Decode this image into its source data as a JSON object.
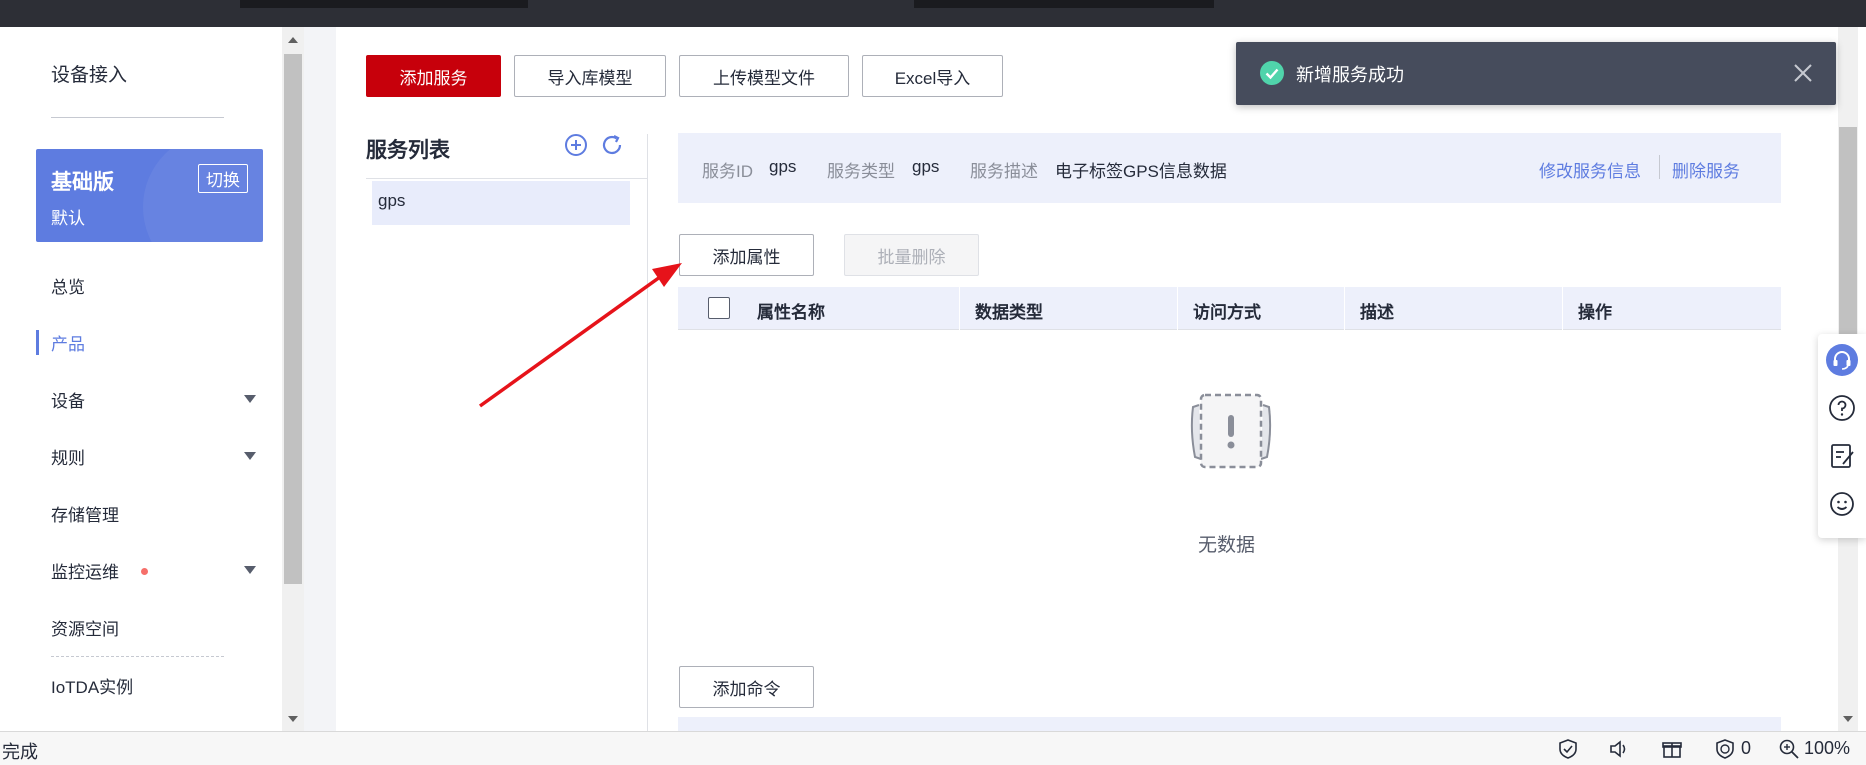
{
  "sidebar": {
    "title": "设备接入",
    "plan": {
      "name": "基础版",
      "sub": "默认",
      "switch_label": "切换"
    },
    "items": [
      {
        "label": "总览"
      },
      {
        "label": "产品",
        "active": true
      },
      {
        "label": "设备",
        "expandable": true
      },
      {
        "label": "规则",
        "expandable": true
      },
      {
        "label": "存储管理"
      },
      {
        "label": "监控运维",
        "expandable": true,
        "badge_dot": true
      },
      {
        "label": "资源空间"
      },
      {
        "label": "IoTDA实例"
      }
    ]
  },
  "toolbar": {
    "add_service": "添加服务",
    "import_model": "导入库模型",
    "upload_model": "上传模型文件",
    "excel_import": "Excel导入"
  },
  "service_list": {
    "title": "服务列表",
    "items": [
      {
        "label": "gps"
      }
    ]
  },
  "service_info": {
    "id_label": "服务ID",
    "id_value": "gps",
    "type_label": "服务类型",
    "type_value": "gps",
    "desc_label": "服务描述",
    "desc_value": "电子标签GPS信息数据",
    "edit_link": "修改服务信息",
    "delete_link": "删除服务"
  },
  "properties": {
    "add_button": "添加属性",
    "batch_delete_button": "批量删除",
    "columns": [
      "属性名称",
      "数据类型",
      "访问方式",
      "描述",
      "操作"
    ],
    "empty_text": "无数据"
  },
  "commands": {
    "add_button": "添加命令"
  },
  "toast": {
    "message": "新增服务成功"
  },
  "statusbar": {
    "left": "完成",
    "count": "0",
    "zoom": "100%"
  },
  "colors": {
    "brand_red": "#c7000b",
    "accent_blue": "#5e7ce0",
    "success_green": "#50d4ab",
    "toast_bg": "#464c5c",
    "annotation_arrow": "#e6131a"
  }
}
